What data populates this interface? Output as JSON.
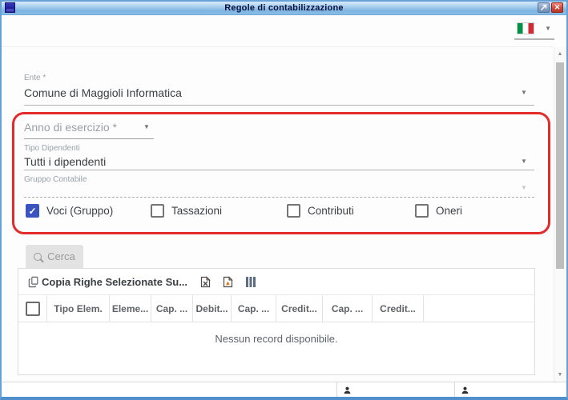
{
  "window": {
    "title": "Regole di contabilizzazione"
  },
  "language_selector": {
    "selected_language": "italiano",
    "flag_colors": {
      "green": "#009246",
      "white": "#ffffff",
      "red": "#ce2b37"
    }
  },
  "form": {
    "ente": {
      "label": "Ente *",
      "value": "Comune di Maggioli Informatica"
    },
    "anno_di_esercizio": {
      "placeholder": "Anno di esercizio *",
      "value": ""
    },
    "tipo_dipendenti": {
      "label": "Tipo Dipendenti",
      "value": "Tutti i dipendenti"
    },
    "gruppo_contabile": {
      "label": "Gruppo Contabile",
      "value": "",
      "disabled": true
    },
    "checkboxes": [
      {
        "label": "Voci (Gruppo)",
        "checked": true
      },
      {
        "label": "Tassazioni",
        "checked": false
      },
      {
        "label": "Contributi",
        "checked": false
      },
      {
        "label": "Oneri",
        "checked": false
      }
    ]
  },
  "actions": {
    "search_label": "Cerca",
    "search_enabled": false
  },
  "table": {
    "toolbar": {
      "copy_label": "Copia Righe Selezionate Su..."
    },
    "columns": [
      "Tipo Elem.",
      "Eleme...",
      "Cap. ...",
      "Debit...",
      "Cap. ...",
      "Credit...",
      "Cap. ...",
      "Credit...",
      ""
    ],
    "empty_message": "Nessun record disponibile."
  },
  "colors": {
    "checkbox_accent": "#3a53c0",
    "annotation_red": "#e22b2b",
    "window_border": "#67a1d8",
    "titlebar_top": "#d8ebfa",
    "titlebar_bottom": "#7db4e0",
    "close_button_red": "#d04a3a"
  },
  "icons": {
    "app_icon": "maggioli-logo",
    "restore_icon": "diagonal-arrow",
    "close_icon": "✕",
    "flag_icon": "italian-flag",
    "chevron": "▼",
    "search_icon": "magnifier",
    "copy_icon": "copy-pages",
    "excel_icon": "excel-file",
    "pdf_icon": "pdf-file",
    "columns_icon": "column-bars",
    "check_icon": "✓",
    "person_icon": "user-silhouette",
    "scroll_up": "▲",
    "scroll_down": "▼"
  }
}
